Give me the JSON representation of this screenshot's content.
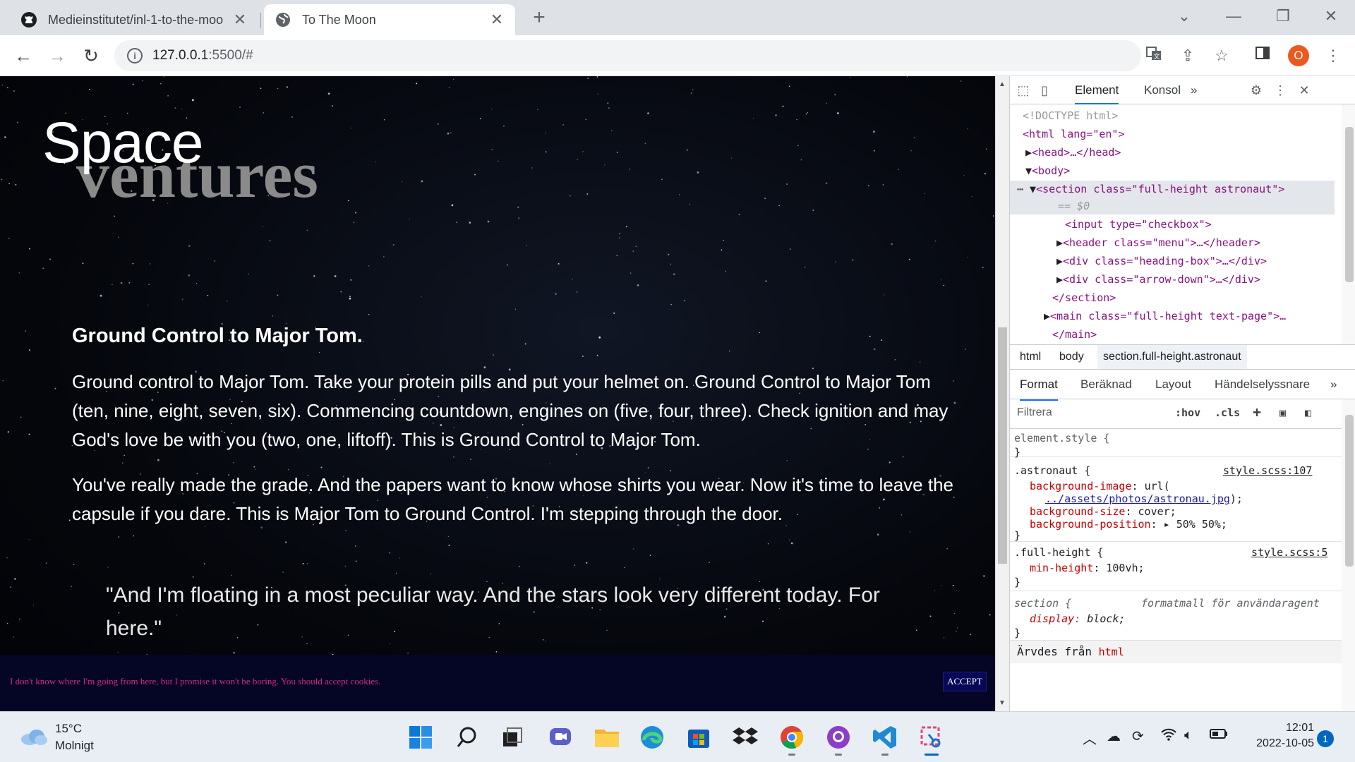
{
  "browser": {
    "tabs": [
      {
        "title": "Medieinstitutet/inl-1-to-the-moo",
        "icon": "github-icon"
      },
      {
        "title": "To The Moon",
        "icon": "globe-icon"
      }
    ],
    "new_tab_symbol": "+",
    "url_host": "127.0.0.1",
    "url_rest": ":5500/#",
    "profile_initial": "O"
  },
  "page": {
    "title_word1": "Space",
    "title_word2": "ventures",
    "heading": "Ground Control to Major Tom.",
    "paragraph1": "Ground control to Major Tom. Take your protein pills and put your helmet on. Ground Control to Major Tom (ten, nine, eight, seven, six). Commencing countdown, engines on (five, four, three). Check ignition and may God's love be with you (two, one, liftoff). This is Ground Control to Major Tom.",
    "paragraph2": "You've really made the grade. And the papers want to know whose shirts you wear. Now it's time to leave the capsule if you dare. This is Major Tom to Ground Control. I'm stepping through the door.",
    "quote": "\"And I'm floating in a most peculiar way. And the stars look very different today. For here.\"",
    "cookie_message": "I don't know where I'm going from here, but I promise it won't be boring. You should accept cookies.",
    "cookie_button": "ACCEPT"
  },
  "devtools": {
    "tabs": {
      "elements": "Element",
      "console": "Konsol",
      "more": "»"
    },
    "dom": {
      "doctype": "<!DOCTYPE html>",
      "html_open": "<html lang=\"en\">",
      "head": "<head>…</head>",
      "body_open": "<body>",
      "section_open": "<section class=\"full-height astronaut\">",
      "section_eq": "== $0",
      "input": "<input type=\"checkbox\">",
      "header": "<header class=\"menu\">…</header>",
      "div_heading": "<div class=\"heading-box\">…</div>",
      "div_arrow": "<div class=\"arrow-down\">…</div>",
      "section_close": "</section>",
      "main_open": "<main class=\"full-height text-page\">…",
      "main_close": "</main>"
    },
    "breadcrumbs": [
      "html",
      "body",
      "section.full-height.astronaut"
    ],
    "style_tabs": [
      "Format",
      "Beräknad",
      "Layout",
      "Händelselyssnare",
      "»"
    ],
    "filter_placeholder": "Filtrera",
    "filter_hov": ":hov",
    "filter_cls": ".cls",
    "rules": {
      "element_style": "element.style {",
      "close": "}",
      "astronaut_selector": ".astronaut {",
      "astronaut_source": "style.scss:107",
      "bg_image_prop": "background-image",
      "bg_image_val": "url(",
      "bg_image_link": "../assets/photos/astronau.jpg",
      "bg_image_end": ");",
      "bg_size_prop": "background-size",
      "bg_size_val": "cover;",
      "bg_pos_prop": "background-position",
      "bg_pos_val": "50% 50%;",
      "fullheight_selector": ".full-height {",
      "fullheight_source": "style.scss:5",
      "minheight_prop": "min-height",
      "minheight_val": "100vh;",
      "section_selector": "section {",
      "section_source": "formatmall för användaragent",
      "display_prop": "display",
      "display_val": "block;",
      "inherited_label": "Ärvdes från",
      "inherited_tag": "html"
    }
  },
  "taskbar": {
    "temperature": "15°C",
    "weather": "Molnigt",
    "time": "12:01",
    "date": "2022-10-05",
    "notifications": "1"
  }
}
